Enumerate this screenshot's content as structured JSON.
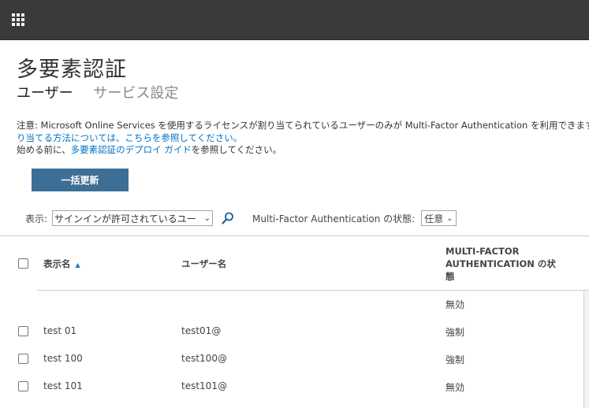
{
  "page": {
    "title": "多要素認証",
    "tabs": [
      {
        "label": "ユーザー",
        "active": true
      },
      {
        "label": "サービス設定",
        "active": false
      }
    ]
  },
  "notice": {
    "line1": "注意: Microsoft Online Services を使用するライセンスが割り当てられているユーザーのみが Multi-Factor Authentication を利用できます",
    "line2_link": "り当てる方法については、こちらを参照してください。",
    "line3_prefix": "始める前に、",
    "line3_link": "多要素認証のデプロイ ガイド",
    "line3_suffix": "を参照してください。"
  },
  "toolbar": {
    "bulk_update_label": "一括更新"
  },
  "filters": {
    "view_label": "表示:",
    "view_value": "サインインが許可されているユー",
    "mfa_state_label": "Multi-Factor Authentication の状態:",
    "mfa_state_value": "任意"
  },
  "table": {
    "headers": {
      "display_name": "表示名",
      "user_name": "ユーザー名",
      "mfa_state": "MULTI-FACTOR AUTHENTICATION の状態"
    },
    "rows": [
      {
        "display_name": "",
        "user_name": "",
        "mfa_state": "無効"
      },
      {
        "display_name": "test 01",
        "user_name": "test01@",
        "mfa_state": "強制"
      },
      {
        "display_name": "test 100",
        "user_name": "test100@",
        "mfa_state": "強制"
      },
      {
        "display_name": "test 101",
        "user_name": "test101@",
        "mfa_state": "無効"
      }
    ]
  },
  "colors": {
    "topbar": "#3a3a3a",
    "button": "#3d6e96",
    "link": "#0072c6",
    "sort_arrow": "#1976c6"
  }
}
